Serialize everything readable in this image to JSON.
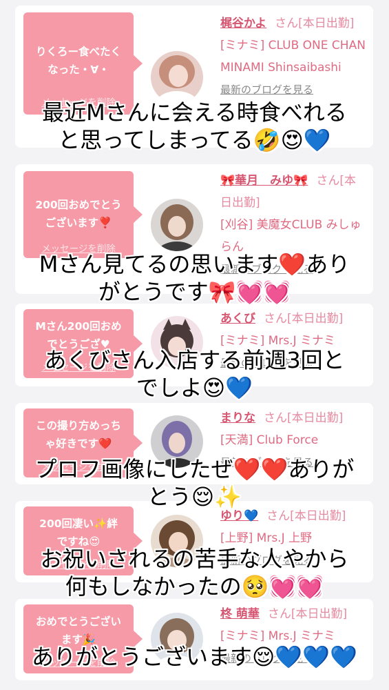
{
  "colors": {
    "bubble": "#f59aa6",
    "name": "#d65671",
    "info_text": "#e06a82",
    "page_bg": "#f3f3f5"
  },
  "cards": [
    {
      "message": "りくろー食べたく\nなった・∀・",
      "delete_label": "メッセージを削除",
      "name": "梶谷かよ",
      "suffix": "さん[本日出勤]",
      "shop": "[ミナミ] CLUB ONE CHAN MINAMI Shinsaibashi",
      "blog_label": "最新のブログを見る",
      "caption": "最近Mさんに会える時食べれる\nと思ってしまってる🤣😍💙"
    },
    {
      "message": "200回おめでとう\nございます❣️",
      "delete_label": "メッセージを削除",
      "name": "🎀華月　みゆ🎀",
      "suffix": "さん[本日出勤]",
      "shop": "[刈谷] 美魔女CLUB みしゅらん",
      "blog_label": "最新のブログを見る",
      "caption": "Mさん見てるの思います❤️あり\nがとうです🎀💓💓"
    },
    {
      "message": "Mさん200回おめ\nでとうござ♥",
      "delete_label": "メッセージを削除",
      "name": "あくび",
      "suffix": "さん[本日出勤]",
      "shop": "[ミナミ] Mrs.J ミナミ",
      "blog_label": "最新のブログを見る",
      "caption": "あくびさん入店する前週3回と\nでしよ😍💙"
    },
    {
      "message": "この撮り方めっち\nゃ好きです❤️",
      "delete_label": "メッセージを削除",
      "name": "まりな",
      "suffix": "さん[本日出勤]",
      "shop": "[天満] Club Force",
      "blog_label": "最新のブログを見る",
      "caption": "プロフ画像にしたぜ❤️❤️ありが\nとう😌✨"
    },
    {
      "message": "200回凄い✨絆\nですね😍",
      "delete_label": "メッセージを削除",
      "name": "ゆり💙",
      "suffix": "さん[本日出勤]",
      "shop": "[上野] Mrs.J 上野",
      "blog_label": "最新のブログを見る",
      "caption": "お祝いされるの苦手な人やから\n何もしなかったの🥺💓💓"
    },
    {
      "message": "おめでとうござい\nます🎉",
      "delete_label": "メッセージを削除",
      "name": "柊 萌華",
      "suffix": "さん[本日出勤]",
      "shop": "[ミナミ] Mrs.J ミナミ",
      "blog_label": "最新のブログを見る",
      "caption": "ありがとうございます😌💙💙💙"
    }
  ]
}
